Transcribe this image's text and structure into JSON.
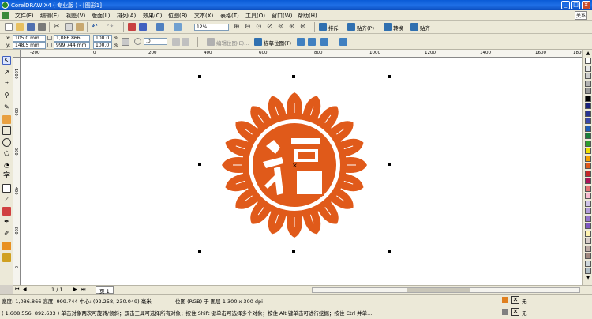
{
  "window": {
    "title": "CorelDRAW X4 ( 专业版 ) - [图形1]"
  },
  "menu": {
    "items": [
      "文件(F)",
      "编辑(E)",
      "视图(V)",
      "版面(L)",
      "排列(A)",
      "效果(C)",
      "位图(B)",
      "文本(X)",
      "表格(T)",
      "工具(O)",
      "窗口(W)",
      "帮助(H)"
    ],
    "corner_label": "关系"
  },
  "toolbar": {
    "zoom": "12%",
    "trace_label": "排斥",
    "snap_label": "贴齐(P)",
    "convert_label": "转换",
    "paste_label": "贴齐"
  },
  "propbar": {
    "x_label": "x:",
    "x_value": "105.0 mm",
    "y_label": "y:",
    "y_value": "148.5 mm",
    "w_value": "1,086.866 mm",
    "h_value": "999.744 mm",
    "scale_w": "100.0",
    "scale_h": "100.0",
    "pct": "%",
    "angle": ".0",
    "edit_bitmap": "编辑位图(E)...",
    "trace_bitmap": "描摹位图(T)"
  },
  "ruler": {
    "h_ticks": [
      "-200",
      "0",
      "200",
      "400",
      "600",
      "800",
      "1000",
      "1200",
      "1400",
      "1600",
      "1800"
    ],
    "v_ticks": [
      "1000",
      "800",
      "600",
      "400",
      "200",
      "0"
    ]
  },
  "pagenav": {
    "count": "1 / 1",
    "page_tab": "页 1"
  },
  "status": {
    "line1_left": "宽度: 1,086.866  高度: 999.744  中心: (92.258, 230.049)  毫米",
    "line1_mid": "位图 (RGB) 于 图层 1 300 x 300 dpi",
    "line2": "( 1,608.556, 892.633 ) 单击对象两次可旋转/倾斜；双击工具可选择所有对象；按住 Shift 键单击可选择多个对象；按住 Alt 键单击可进行挖掘；按住 Ctrl 并单...",
    "fill_none": "无",
    "outline_none": "无"
  },
  "colors": {
    "emblem": "#e05a1a",
    "title_bar": "#0a5bd6",
    "chrome": "#ece9d8"
  },
  "palette": [
    "#ffffff",
    "#e6e6e6",
    "#cccccc",
    "#b3b3b3",
    "#999999",
    "#000000",
    "#1a237e",
    "#283593",
    "#3949ab",
    "#1e5eb8",
    "#1b7f3a",
    "#2e9e2e",
    "#f0e000",
    "#f5a000",
    "#e05a1a",
    "#c62828",
    "#ad1457",
    "#e57373",
    "#f8bbd0",
    "#d1c4e9",
    "#b39ddb",
    "#9575cd",
    "#7e57c2",
    "#fff3b0",
    "#d7ccc8",
    "#bcaaa4",
    "#a1887f",
    "#cfd8dc",
    "#b0bec5"
  ]
}
